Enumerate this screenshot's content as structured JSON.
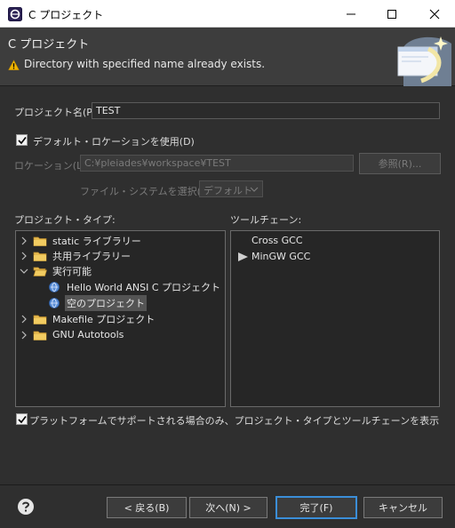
{
  "window": {
    "title": "C プロジェクト"
  },
  "header": {
    "heading": "C プロジェクト",
    "message": "Directory with specified name already exists."
  },
  "form": {
    "project_name_label": "プロジェクト名(P):",
    "project_name_value": "TEST",
    "use_default_location_label": "デフォルト・ロケーションを使用(D)",
    "use_default_location_checked": true,
    "location_label": "ロケーション(L):",
    "location_value": "C:¥pleiades¥workspace¥TEST",
    "browse_label": "参照(R)...",
    "filesystem_label": "ファイル・システムを選択(Y):",
    "filesystem_value": "デフォルト"
  },
  "project_types": {
    "label": "プロジェクト・タイプ:",
    "items": [
      {
        "label": "static ライブラリー",
        "expanded": false
      },
      {
        "label": "共用ライブラリー",
        "expanded": false
      },
      {
        "label": "実行可能",
        "expanded": true
      },
      {
        "label": "Hello World ANSI C プロジェクト"
      },
      {
        "label": "空のプロジェクト",
        "selected": true
      },
      {
        "label": "Makefile プロジェクト",
        "expanded": false
      },
      {
        "label": "GNU Autotools",
        "expanded": false
      }
    ]
  },
  "toolchains": {
    "label": "ツールチェーン:",
    "items": [
      {
        "label": "Cross GCC",
        "default": false
      },
      {
        "label": "MinGW GCC",
        "default": true
      }
    ]
  },
  "filter": {
    "label": "プラットフォームでサポートされる場合のみ、プロジェクト・タイプとツールチェーンを表示",
    "checked": true
  },
  "buttons": {
    "back": "< 戻る(B)",
    "next": "次へ(N) >",
    "finish": "完了(F)",
    "cancel": "キャンセル"
  },
  "colors": {
    "accent": "#3b8ed8",
    "warning": "#f0b400",
    "background": "#2f2f2f"
  }
}
